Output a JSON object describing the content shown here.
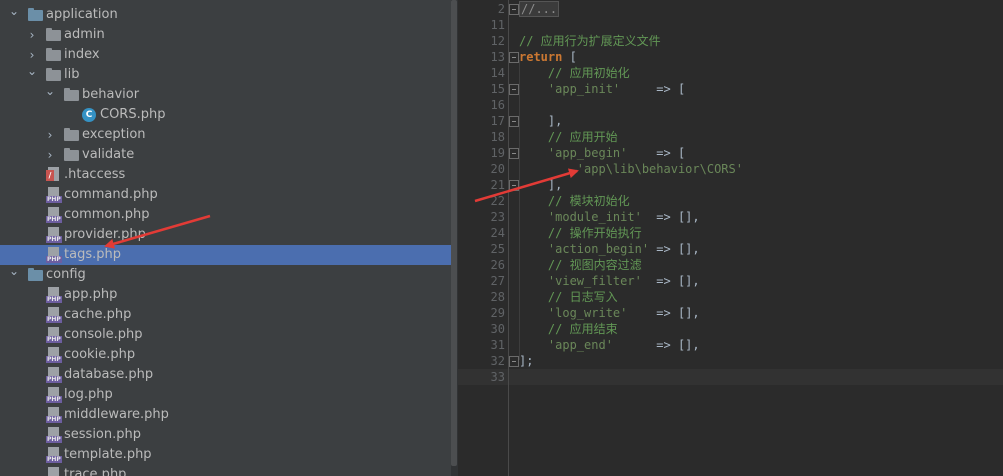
{
  "tree": {
    "items": [
      {
        "label": "application",
        "icon": "folder-icon",
        "expanded": true,
        "type": "folder"
      },
      {
        "label": "admin",
        "icon": "folder-icon",
        "expanded": false,
        "type": "folder"
      },
      {
        "label": "index",
        "icon": "folder-icon",
        "expanded": false,
        "type": "folder"
      },
      {
        "label": "lib",
        "icon": "folder-icon",
        "expanded": true,
        "type": "folder"
      },
      {
        "label": "behavior",
        "icon": "folder-icon",
        "expanded": true,
        "type": "folder"
      },
      {
        "label": "CORS.php",
        "icon": "php-class-icon",
        "type": "class"
      },
      {
        "label": "exception",
        "icon": "folder-icon",
        "expanded": false,
        "type": "folder"
      },
      {
        "label": "validate",
        "icon": "folder-icon",
        "expanded": false,
        "type": "folder"
      },
      {
        "label": ".htaccess",
        "icon": "htaccess-icon",
        "type": "htaccess"
      },
      {
        "label": "command.php",
        "icon": "php-file-icon",
        "type": "php"
      },
      {
        "label": "common.php",
        "icon": "php-file-icon",
        "type": "php"
      },
      {
        "label": "provider.php",
        "icon": "php-file-icon",
        "type": "php"
      },
      {
        "label": "tags.php",
        "icon": "php-file-icon",
        "type": "php",
        "selected": true
      },
      {
        "label": "config",
        "icon": "folder-icon",
        "expanded": true,
        "type": "folder"
      },
      {
        "label": "app.php",
        "icon": "php-file-icon",
        "type": "php"
      },
      {
        "label": "cache.php",
        "icon": "php-file-icon",
        "type": "php"
      },
      {
        "label": "console.php",
        "icon": "php-file-icon",
        "type": "php"
      },
      {
        "label": "cookie.php",
        "icon": "php-file-icon",
        "type": "php"
      },
      {
        "label": "database.php",
        "icon": "php-file-icon",
        "type": "php"
      },
      {
        "label": "log.php",
        "icon": "php-file-icon",
        "type": "php"
      },
      {
        "label": "middleware.php",
        "icon": "php-file-icon",
        "type": "php"
      },
      {
        "label": "session.php",
        "icon": "php-file-icon",
        "type": "php"
      },
      {
        "label": "template.php",
        "icon": "php-file-icon",
        "type": "php"
      },
      {
        "label": "trace.php",
        "icon": "php-file-icon",
        "type": "php"
      }
    ]
  },
  "editor": {
    "lines": [
      {
        "n": "2",
        "text": "//...",
        "collapsed": true,
        "fold": true
      },
      {
        "n": "11",
        "text": ""
      },
      {
        "n": "12",
        "text": "// 应用行为扩展定义文件",
        "kind": "comment"
      },
      {
        "n": "13",
        "text": "return [",
        "kind": "keyword",
        "fold": true
      },
      {
        "n": "14",
        "text": "    // 应用初始化",
        "kind": "comment"
      },
      {
        "n": "15",
        "text": "    'app_init'     => [",
        "kind": "entry",
        "fold": true
      },
      {
        "n": "16",
        "text": ""
      },
      {
        "n": "17",
        "text": "    ],",
        "fold": true
      },
      {
        "n": "18",
        "text": "    // 应用开始",
        "kind": "comment"
      },
      {
        "n": "19",
        "text": "    'app_begin'    => [",
        "kind": "entry",
        "fold": true
      },
      {
        "n": "20",
        "text": "        'app\\lib\\behavior\\CORS'",
        "kind": "string"
      },
      {
        "n": "21",
        "text": "    ],",
        "fold": true
      },
      {
        "n": "22",
        "text": "    // 模块初始化",
        "kind": "comment"
      },
      {
        "n": "23",
        "text": "    'module_init'  => [],",
        "kind": "entry"
      },
      {
        "n": "24",
        "text": "    // 操作开始执行",
        "kind": "comment"
      },
      {
        "n": "25",
        "text": "    'action_begin' => [],",
        "kind": "entry"
      },
      {
        "n": "26",
        "text": "    // 视图内容过滤",
        "kind": "comment"
      },
      {
        "n": "27",
        "text": "    'view_filter'  => [],",
        "kind": "entry"
      },
      {
        "n": "28",
        "text": "    // 日志写入",
        "kind": "comment"
      },
      {
        "n": "29",
        "text": "    'log_write'    => [],",
        "kind": "entry"
      },
      {
        "n": "30",
        "text": "    // 应用结束",
        "kind": "comment"
      },
      {
        "n": "31",
        "text": "    'app_end'      => [],",
        "kind": "entry"
      },
      {
        "n": "32",
        "text": "];",
        "fold": true
      },
      {
        "n": "33",
        "text": "",
        "current": true
      }
    ]
  },
  "colors": {
    "comment": "#629755",
    "keyword": "#cc7832",
    "string": "#6a8759",
    "default": "#a9b7c6",
    "selection": "#4b6eaf",
    "arrow": "#e23b36"
  }
}
